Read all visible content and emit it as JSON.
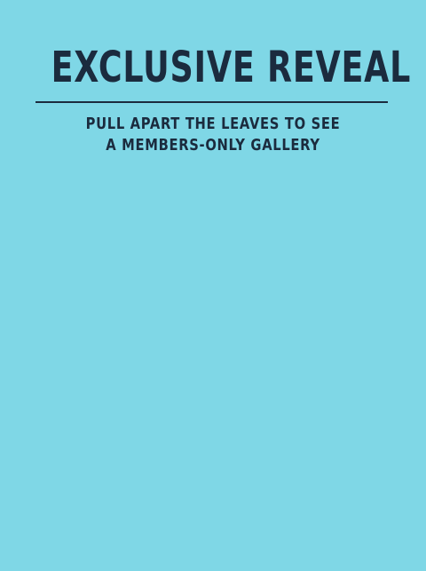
{
  "title": "EXCLUSIVE REVEAL",
  "subtitle": {
    "line1": "PULL APART THE LEAVES TO SEE",
    "line2": "A MEMBERS-ONLY GALLERY"
  },
  "colors": {
    "background": "#7fd7e6",
    "text": "#1b2b3e",
    "divider": "#1b2b3e"
  }
}
